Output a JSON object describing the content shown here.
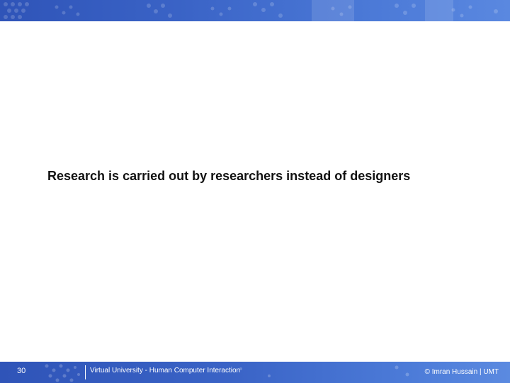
{
  "slide": {
    "main_text": "Research is carried out by researchers instead of designers",
    "slide_number": "30",
    "footer_course": "Virtual University - Human Computer Interaction",
    "footer_credit": "© Imran Hussain | UMT"
  },
  "colors": {
    "banner": "#3a63c6",
    "footer": "#3a63c6",
    "text": "#111111",
    "background": "#ffffff"
  }
}
